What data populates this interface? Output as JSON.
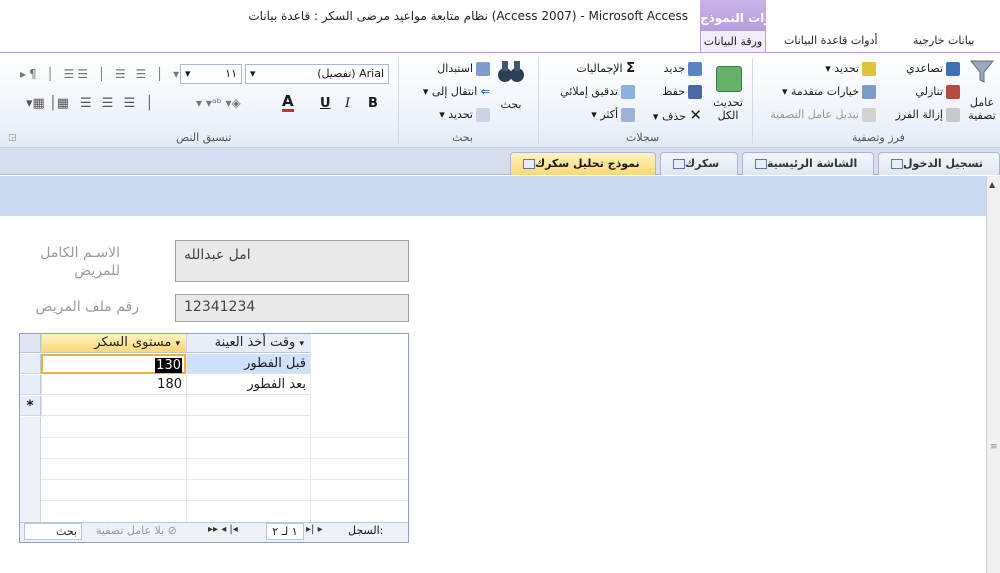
{
  "window": {
    "title": "نظام متابعة مواعيد مرضى السكر : قاعدة بيانات (Access 2007) - Microsoft Access",
    "tools_header": "أدوات النموذج"
  },
  "ribbon_tabs": {
    "datasheet": "ورقة البيانات",
    "db_tools": "أدوات قاعدة البيانات",
    "external": "بيانات خارجية"
  },
  "ribbon": {
    "sort_filter": {
      "label": "فرز وتصفية",
      "filter": "عامل تصفية",
      "ascending": "تصاعدي",
      "descending": "تنازلي",
      "remove_sort": "إزالة الفرز",
      "selection": "تحديد",
      "advanced": "خيارات متقدمة",
      "toggle_filter": "تبديل عامل التصفية"
    },
    "records": {
      "label": "سجلات",
      "refresh": "تحديث الكل",
      "new": "جديد",
      "save": "حفظ",
      "delete": "حذف",
      "totals": "الإجماليات",
      "spelling": "تدقيق إملائي",
      "more": "أكثر"
    },
    "find": {
      "label": "بحث",
      "find": "بحث",
      "replace": "استبدال",
      "goto": "انتقال إلى",
      "select": "تحديد"
    },
    "text_format": {
      "label": "تنسيق النص",
      "font": "Arial (تفصيل)",
      "size": "١١",
      "bold": "B",
      "italic": "I",
      "underline": "U",
      "font_color_letter": "A"
    }
  },
  "doc_tabs": [
    {
      "label": "تسجيل الدخول",
      "active": false
    },
    {
      "label": "الشاشة الرئيسية",
      "active": false
    },
    {
      "label": "سكرك",
      "active": false
    },
    {
      "label": "نموذج تحليل سكرك",
      "active": true
    }
  ],
  "form": {
    "name_label": "الاسـم الكامل للمريض",
    "name_value": "امل عبدالله",
    "file_label": "رقم ملف المريض",
    "file_value": "12341234"
  },
  "subform": {
    "columns": [
      "وقت أخذ العينة",
      "مستوى السكر"
    ],
    "rows": [
      {
        "time": "قبل الفطور",
        "level": "130"
      },
      {
        "time": "بعد الفطور",
        "level": "180"
      }
    ],
    "new_row_marker": "*",
    "nav": {
      "record_label": "السجل:",
      "position": "١ لـ ٢",
      "no_filter": "بلا عامل تصفية",
      "search": "بحث"
    }
  },
  "colors": {
    "accent_purple": "#b89ce0",
    "form_band": "#c9d9f0",
    "active_tab": "#fbd874",
    "ribbon_bg": "#eef3fa"
  }
}
